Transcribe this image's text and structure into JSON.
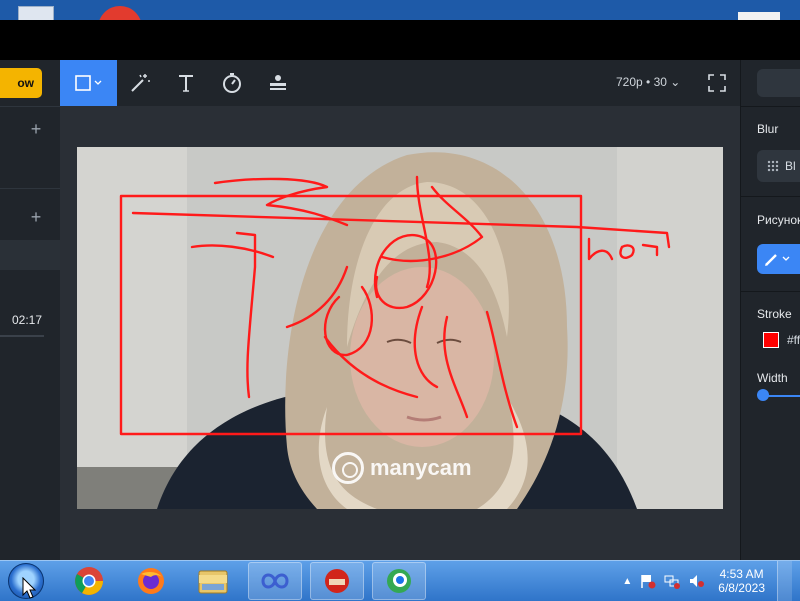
{
  "colors": {
    "accent": "#3b86f5",
    "yellow": "#f4b400",
    "drawing": "#ff0000"
  },
  "left_panel": {
    "yellow_button_label": "ow",
    "timer": "02:17"
  },
  "toolbar": {
    "resolution_fps": "720p • 30",
    "tools": [
      {
        "name": "select",
        "icon": "square-select-icon"
      },
      {
        "name": "magic",
        "icon": "magic-wand-icon"
      },
      {
        "name": "text",
        "icon": "text-icon"
      },
      {
        "name": "timer",
        "icon": "timer-icon"
      },
      {
        "name": "lower-third",
        "icon": "lower-third-icon"
      }
    ]
  },
  "video": {
    "watermark": "manycam",
    "handwriting_text": "поз"
  },
  "right_panel": {
    "blur_title": "Blur",
    "blur_option": "Bl",
    "drawing_title": "Рисунок",
    "stroke_title": "Stroke",
    "stroke_value": "#ff",
    "width_title": "Width"
  },
  "taskbar": {
    "apps": [
      {
        "name": "chrome",
        "icon": "chrome-icon"
      },
      {
        "name": "firefox",
        "icon": "firefox-icon"
      },
      {
        "name": "explorer",
        "icon": "folder-icon"
      },
      {
        "name": "app-infinity",
        "icon": "infinity-icon"
      },
      {
        "name": "app-red",
        "icon": "red-app-icon"
      },
      {
        "name": "manycam",
        "icon": "manycam-icon"
      }
    ],
    "clock_time": "4:53 AM",
    "clock_date": "6/8/2023"
  }
}
